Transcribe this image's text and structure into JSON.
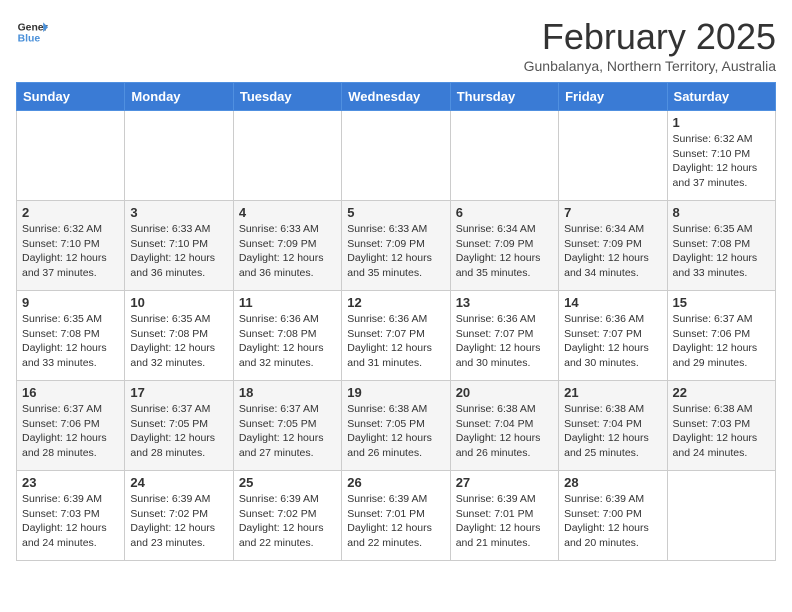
{
  "header": {
    "logo_line1": "General",
    "logo_line2": "Blue",
    "month_title": "February 2025",
    "location": "Gunbalanya, Northern Territory, Australia"
  },
  "weekdays": [
    "Sunday",
    "Monday",
    "Tuesday",
    "Wednesday",
    "Thursday",
    "Friday",
    "Saturday"
  ],
  "weeks": [
    [
      {
        "day": "",
        "info": ""
      },
      {
        "day": "",
        "info": ""
      },
      {
        "day": "",
        "info": ""
      },
      {
        "day": "",
        "info": ""
      },
      {
        "day": "",
        "info": ""
      },
      {
        "day": "",
        "info": ""
      },
      {
        "day": "1",
        "info": "Sunrise: 6:32 AM\nSunset: 7:10 PM\nDaylight: 12 hours\nand 37 minutes."
      }
    ],
    [
      {
        "day": "2",
        "info": "Sunrise: 6:32 AM\nSunset: 7:10 PM\nDaylight: 12 hours\nand 37 minutes."
      },
      {
        "day": "3",
        "info": "Sunrise: 6:33 AM\nSunset: 7:10 PM\nDaylight: 12 hours\nand 36 minutes."
      },
      {
        "day": "4",
        "info": "Sunrise: 6:33 AM\nSunset: 7:09 PM\nDaylight: 12 hours\nand 36 minutes."
      },
      {
        "day": "5",
        "info": "Sunrise: 6:33 AM\nSunset: 7:09 PM\nDaylight: 12 hours\nand 35 minutes."
      },
      {
        "day": "6",
        "info": "Sunrise: 6:34 AM\nSunset: 7:09 PM\nDaylight: 12 hours\nand 35 minutes."
      },
      {
        "day": "7",
        "info": "Sunrise: 6:34 AM\nSunset: 7:09 PM\nDaylight: 12 hours\nand 34 minutes."
      },
      {
        "day": "8",
        "info": "Sunrise: 6:35 AM\nSunset: 7:08 PM\nDaylight: 12 hours\nand 33 minutes."
      }
    ],
    [
      {
        "day": "9",
        "info": "Sunrise: 6:35 AM\nSunset: 7:08 PM\nDaylight: 12 hours\nand 33 minutes."
      },
      {
        "day": "10",
        "info": "Sunrise: 6:35 AM\nSunset: 7:08 PM\nDaylight: 12 hours\nand 32 minutes."
      },
      {
        "day": "11",
        "info": "Sunrise: 6:36 AM\nSunset: 7:08 PM\nDaylight: 12 hours\nand 32 minutes."
      },
      {
        "day": "12",
        "info": "Sunrise: 6:36 AM\nSunset: 7:07 PM\nDaylight: 12 hours\nand 31 minutes."
      },
      {
        "day": "13",
        "info": "Sunrise: 6:36 AM\nSunset: 7:07 PM\nDaylight: 12 hours\nand 30 minutes."
      },
      {
        "day": "14",
        "info": "Sunrise: 6:36 AM\nSunset: 7:07 PM\nDaylight: 12 hours\nand 30 minutes."
      },
      {
        "day": "15",
        "info": "Sunrise: 6:37 AM\nSunset: 7:06 PM\nDaylight: 12 hours\nand 29 minutes."
      }
    ],
    [
      {
        "day": "16",
        "info": "Sunrise: 6:37 AM\nSunset: 7:06 PM\nDaylight: 12 hours\nand 28 minutes."
      },
      {
        "day": "17",
        "info": "Sunrise: 6:37 AM\nSunset: 7:05 PM\nDaylight: 12 hours\nand 28 minutes."
      },
      {
        "day": "18",
        "info": "Sunrise: 6:37 AM\nSunset: 7:05 PM\nDaylight: 12 hours\nand 27 minutes."
      },
      {
        "day": "19",
        "info": "Sunrise: 6:38 AM\nSunset: 7:05 PM\nDaylight: 12 hours\nand 26 minutes."
      },
      {
        "day": "20",
        "info": "Sunrise: 6:38 AM\nSunset: 7:04 PM\nDaylight: 12 hours\nand 26 minutes."
      },
      {
        "day": "21",
        "info": "Sunrise: 6:38 AM\nSunset: 7:04 PM\nDaylight: 12 hours\nand 25 minutes."
      },
      {
        "day": "22",
        "info": "Sunrise: 6:38 AM\nSunset: 7:03 PM\nDaylight: 12 hours\nand 24 minutes."
      }
    ],
    [
      {
        "day": "23",
        "info": "Sunrise: 6:39 AM\nSunset: 7:03 PM\nDaylight: 12 hours\nand 24 minutes."
      },
      {
        "day": "24",
        "info": "Sunrise: 6:39 AM\nSunset: 7:02 PM\nDaylight: 12 hours\nand 23 minutes."
      },
      {
        "day": "25",
        "info": "Sunrise: 6:39 AM\nSunset: 7:02 PM\nDaylight: 12 hours\nand 22 minutes."
      },
      {
        "day": "26",
        "info": "Sunrise: 6:39 AM\nSunset: 7:01 PM\nDaylight: 12 hours\nand 22 minutes."
      },
      {
        "day": "27",
        "info": "Sunrise: 6:39 AM\nSunset: 7:01 PM\nDaylight: 12 hours\nand 21 minutes."
      },
      {
        "day": "28",
        "info": "Sunrise: 6:39 AM\nSunset: 7:00 PM\nDaylight: 12 hours\nand 20 minutes."
      },
      {
        "day": "",
        "info": ""
      }
    ]
  ]
}
